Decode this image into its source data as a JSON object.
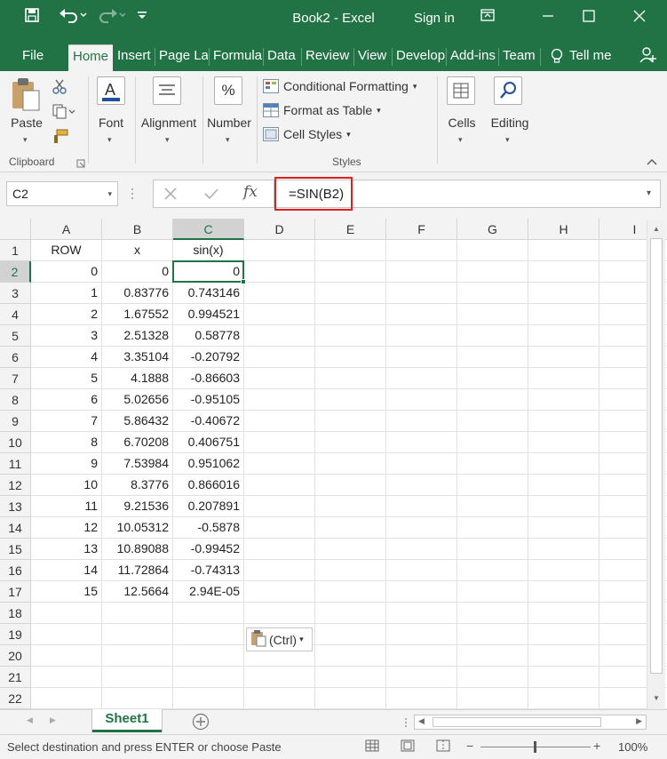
{
  "title_bar": {
    "document_title": "Book2 - Excel",
    "sign_in": "Sign in",
    "save_icon": "save-icon",
    "undo_icon": "undo-icon",
    "redo_icon": "redo-icon",
    "customize_icon": "customize-quick-access-icon"
  },
  "tabs": [
    {
      "label": "File"
    },
    {
      "label": "Home"
    },
    {
      "label": "Insert"
    },
    {
      "label": "Page La"
    },
    {
      "label": "Formula"
    },
    {
      "label": "Data"
    },
    {
      "label": "Review"
    },
    {
      "label": "View"
    },
    {
      "label": "Develop"
    },
    {
      "label": "Add-ins"
    },
    {
      "label": "Team"
    },
    {
      "label": "Tell me"
    }
  ],
  "ribbon": {
    "clipboard": {
      "paste": "Paste",
      "group": "Clipboard"
    },
    "font": {
      "label": "Font"
    },
    "alignment": {
      "label": "Alignment"
    },
    "number": {
      "label": "Number",
      "icon_text": "%"
    },
    "styles": {
      "conditional": "Conditional Formatting",
      "format_table": "Format as Table",
      "cell_styles": "Cell Styles",
      "group": "Styles"
    },
    "cells": {
      "label": "Cells"
    },
    "editing": {
      "label": "Editing"
    }
  },
  "formula_bar": {
    "name_box": "C2",
    "formula": "=SIN(B2)",
    "fx": "fx"
  },
  "sheet": {
    "columns": [
      "A",
      "B",
      "C",
      "D",
      "E",
      "F",
      "G",
      "H",
      "I"
    ],
    "row_numbers": [
      "1",
      "2",
      "3",
      "4",
      "5",
      "6",
      "7",
      "8",
      "9",
      "10",
      "11",
      "12",
      "13",
      "14",
      "15",
      "16",
      "17",
      "18",
      "19",
      "20",
      "21",
      "22"
    ],
    "headers": [
      "ROW",
      "x",
      "sin(x)"
    ],
    "rows": [
      [
        "0",
        "0",
        "0"
      ],
      [
        "1",
        "0.83776",
        "0.743146"
      ],
      [
        "2",
        "1.67552",
        "0.994521"
      ],
      [
        "3",
        "2.51328",
        "0.58778"
      ],
      [
        "4",
        "3.35104",
        "-0.20792"
      ],
      [
        "5",
        "4.1888",
        "-0.86603"
      ],
      [
        "6",
        "5.02656",
        "-0.95105"
      ],
      [
        "7",
        "5.86432",
        "-0.40672"
      ],
      [
        "8",
        "6.70208",
        "0.406751"
      ],
      [
        "9",
        "7.53984",
        "0.951062"
      ],
      [
        "10",
        "8.3776",
        "0.866016"
      ],
      [
        "11",
        "9.21536",
        "0.207891"
      ],
      [
        "12",
        "10.05312",
        "-0.5878"
      ],
      [
        "13",
        "10.89088",
        "-0.99452"
      ],
      [
        "14",
        "11.72864",
        "-0.74313"
      ],
      [
        "15",
        "12.5664",
        "2.94E-05"
      ]
    ],
    "active_cell": "C2",
    "paste_options": "(Ctrl)"
  },
  "sheet_tabs": {
    "active": "Sheet1"
  },
  "status": {
    "message": "Select destination and press ENTER or choose Paste",
    "zoom": "100%"
  },
  "colors": {
    "accent": "#217346",
    "highlight": "#e0201f"
  }
}
